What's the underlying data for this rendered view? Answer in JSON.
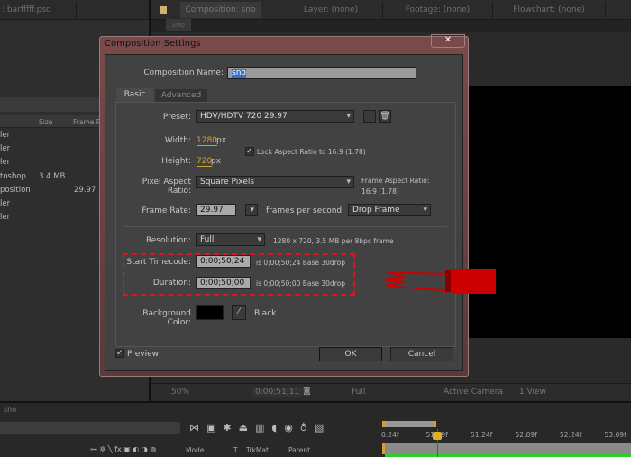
{
  "top_tabs": {
    "project": ": barfffff.psd",
    "composition": "Composition: sno",
    "layer": "Layer: (none)",
    "footage": "Footage: (none)",
    "flowchart": "Flowchart: (none)",
    "comp_chip": "sno"
  },
  "project_panel": {
    "columns": [
      "Size",
      "Frame R"
    ],
    "rows": [
      {
        "name": "ler",
        "size": "",
        "fps": ""
      },
      {
        "name": "ler",
        "size": "",
        "fps": ""
      },
      {
        "name": "ler",
        "size": "",
        "fps": ""
      },
      {
        "name": "toshop",
        "size": "3.4 MB",
        "fps": ""
      },
      {
        "name": "position",
        "size": "",
        "fps": "29.97"
      },
      {
        "name": "ler",
        "size": "",
        "fps": ""
      },
      {
        "name": "ler",
        "size": "",
        "fps": ""
      }
    ]
  },
  "viewer_toolbar": {
    "zoom": "50%",
    "timecode": "0;00;51;11",
    "resolution": "Full",
    "camera": "Active Camera",
    "views": "1 View"
  },
  "timeline": {
    "tab": "sno",
    "columns": {
      "mode": "Mode",
      "t": "T",
      "trkmat": "TrkMat",
      "parent": "Parent"
    },
    "ruler": [
      "0:24f",
      "51:09f",
      "51:24f",
      "52:09f",
      "52:24f",
      "53:09f"
    ],
    "switches": "⊶ ✲ ╲ fx ▣ ◐ ◑ ◍"
  },
  "dialog": {
    "title": "Composition Settings",
    "close": "✕",
    "name_label": "Composition Name:",
    "name_value": "sno",
    "tabs": [
      "Basic",
      "Advanced"
    ],
    "preset_label": "Preset:",
    "preset_value": "HDV/HDTV 720 29.97",
    "width_label": "Width:",
    "width_value": "1280",
    "height_label": "Height:",
    "height_value": "720",
    "px": "px",
    "lock_label": "Lock Aspect Ratio to 16:9 (1.78)",
    "lock_checked": true,
    "par_label": "Pixel Aspect Ratio:",
    "par_value": "Square Pixels",
    "far_label": "Frame Aspect Ratio:",
    "far_value": "16:9 (1.78)",
    "fps_label": "Frame Rate:",
    "fps_value": "29.97",
    "fps_unit": "frames per second",
    "drop_value": "Drop Frame",
    "res_label": "Resolution:",
    "res_value": "Full",
    "res_info": "1280 x 720, 3.5 MB per 8bpc frame",
    "start_label": "Start Timecode:",
    "start_value": "0;00;50;24",
    "start_info": "is 0;00;50;24  Base 30drop",
    "dur_label": "Duration:",
    "dur_value": "0;00;50;00",
    "dur_info": "is 0;00;50;00  Base 30drop",
    "bg_label": "Background Color:",
    "bg_name": "Black",
    "bg_color": "#000000",
    "preview_label": "Preview",
    "preview_checked": true,
    "ok": "OK",
    "cancel": "Cancel"
  },
  "colors": {
    "highlight": "#e0141e",
    "accent_value": "#d4a030",
    "playhead": "#e02020"
  }
}
